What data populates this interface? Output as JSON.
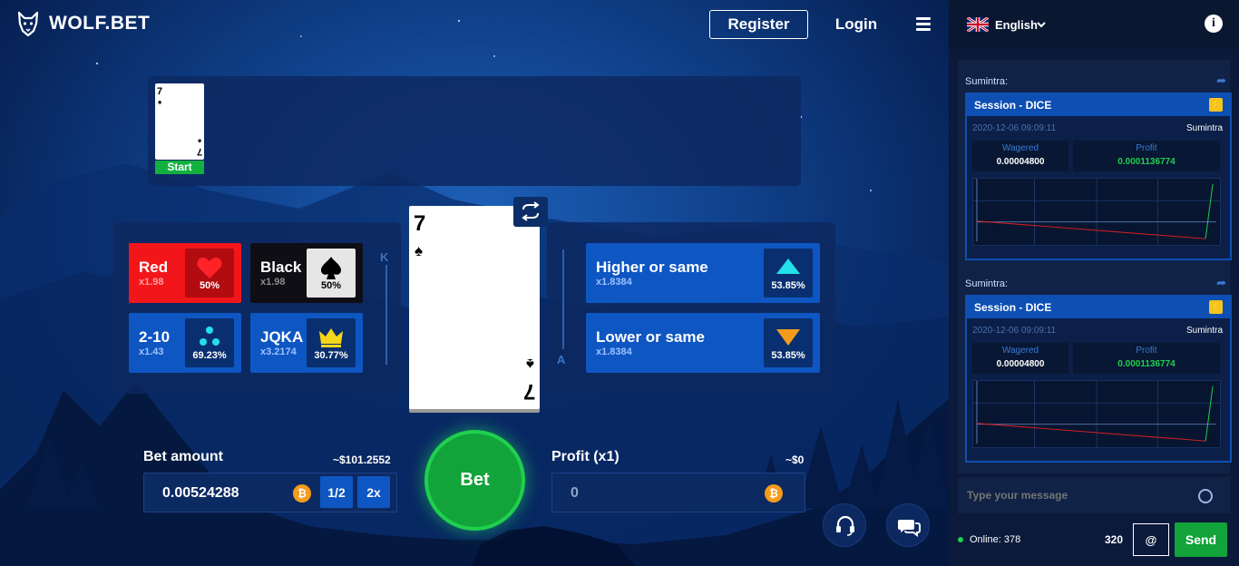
{
  "header": {
    "logo_text": "WOLF.BET",
    "register_label": "Register",
    "login_label": "Login"
  },
  "history": {
    "card_rank": "7",
    "card_suit": "♠",
    "start_label": "Start"
  },
  "current_card": {
    "rank": "7",
    "suit": "♠"
  },
  "scale": {
    "top": "K",
    "bottom": "A"
  },
  "options": {
    "red": {
      "name": "Red",
      "mult": "x1.98",
      "pct": "50%"
    },
    "black": {
      "name": "Black",
      "mult": "x1.98",
      "pct": "50%"
    },
    "range": {
      "name": "2-10",
      "mult": "x1.43",
      "pct": "69.23%"
    },
    "jqka": {
      "name": "JQKA",
      "mult": "x3.2174",
      "pct": "30.77%"
    },
    "higher": {
      "name": "Higher or same",
      "mult": "x1.8384",
      "pct": "53.85%"
    },
    "lower": {
      "name": "Lower or same",
      "mult": "x1.8384",
      "pct": "53.85%"
    }
  },
  "bet": {
    "label": "Bet amount",
    "usd": "~$101.2552",
    "value": "0.00524288",
    "half_label": "1/2",
    "double_label": "2x",
    "button_label": "Bet"
  },
  "profit": {
    "label": "Profit (x1)",
    "usd": "~$0",
    "value": "0"
  },
  "colors": {
    "accent_green": "#12a33a",
    "red_option": "#f2161b",
    "blue_option": "#0e56c2",
    "coin": "#f59b1b"
  },
  "sidebar": {
    "language": "English",
    "messages": [
      {
        "author": "Sumintra:",
        "title": "Session - DICE",
        "date": "2020-12-06 09:09:11",
        "user": "Sumintra",
        "wagered_label": "Wagered",
        "wagered_value": "0.00004800",
        "profit_label": "Profit",
        "profit_value": "0.0001136774"
      },
      {
        "author": "Sumintra:",
        "title": "Session - DICE",
        "date": "2020-12-06 09:09:11",
        "user": "Sumintra",
        "wagered_label": "Wagered",
        "wagered_value": "0.00004800",
        "profit_label": "Profit",
        "profit_value": "0.0001136774"
      }
    ],
    "chat_placeholder": "Type your message",
    "online_text": "Online: 378",
    "char_count": "320",
    "at_label": "@",
    "send_label": "Send"
  }
}
